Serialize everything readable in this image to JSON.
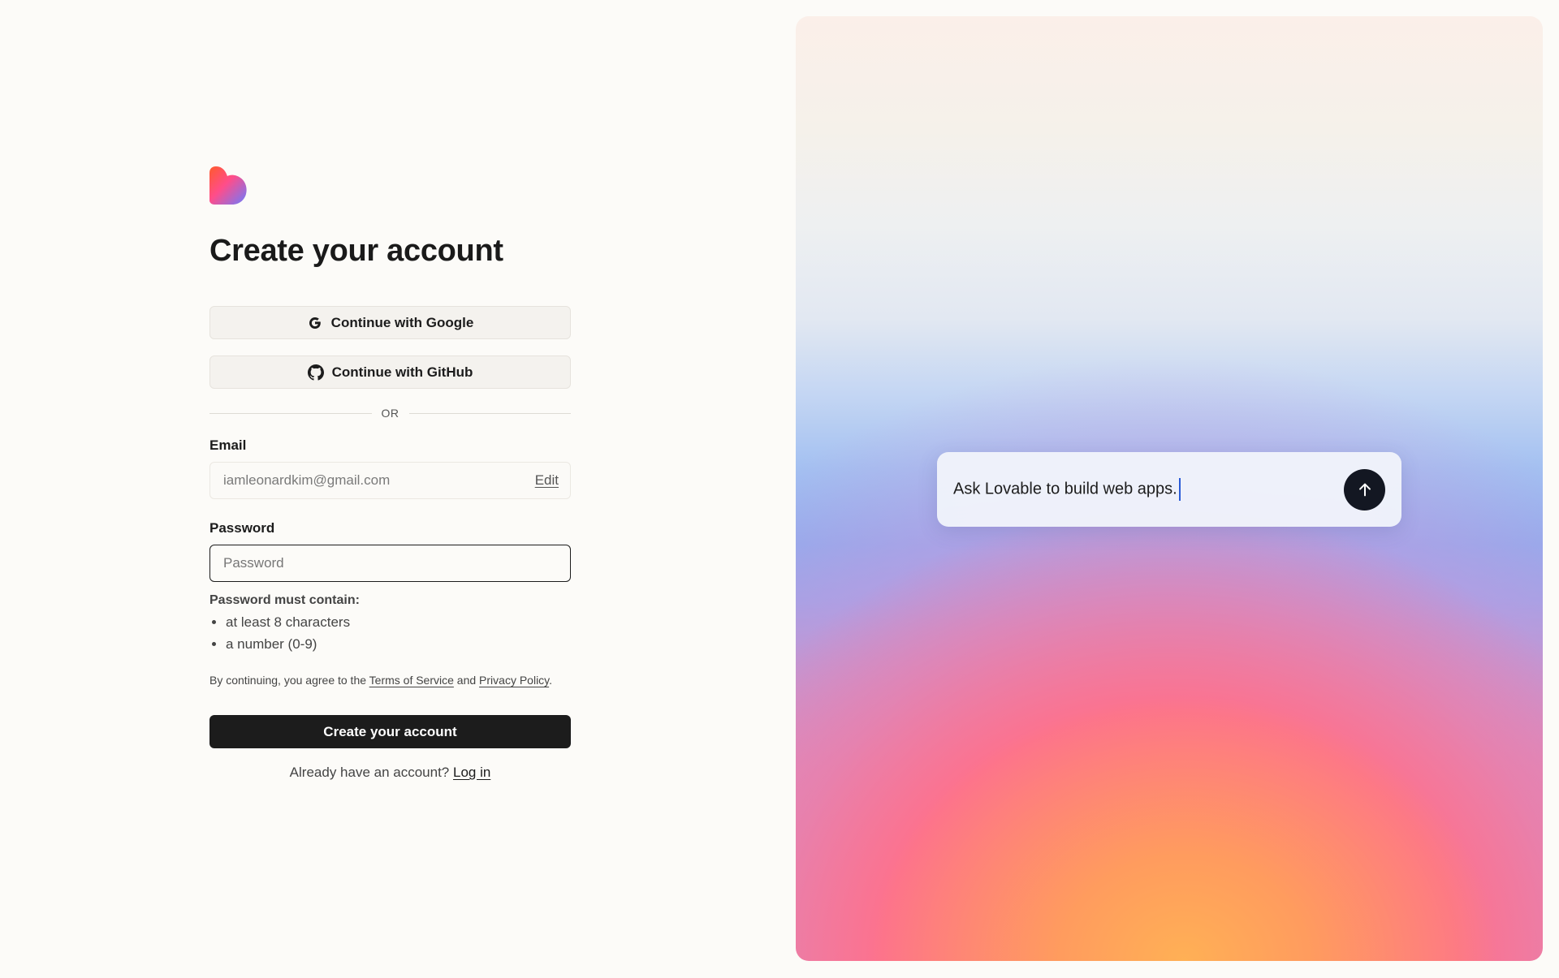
{
  "signup": {
    "title": "Create your account",
    "google_label": "Continue with Google",
    "github_label": "Continue with GitHub",
    "divider_text": "OR",
    "email": {
      "label": "Email",
      "value": "iamleonardkim@gmail.com",
      "edit_label": "Edit"
    },
    "password": {
      "label": "Password",
      "placeholder": "Password"
    },
    "requirements": {
      "title": "Password must contain:",
      "items": [
        "at least 8 characters",
        "a number (0-9)"
      ]
    },
    "terms": {
      "prefix": "By continuing, you agree to the ",
      "tos_label": "Terms of Service",
      "middle": " and ",
      "privacy_label": "Privacy Policy",
      "suffix": "."
    },
    "submit_label": "Create your account",
    "login": {
      "prompt": "Already have an account? ",
      "link_label": "Log in"
    }
  },
  "hero": {
    "prompt_text": "Ask Lovable to build web apps."
  },
  "icons": {
    "logo": "lovable-heart-logo",
    "google": "google-icon",
    "github": "github-icon",
    "send": "arrow-up-icon"
  },
  "colors": {
    "background": "#fcfbf8",
    "primary_button": "#1c1c1c",
    "send_button": "#131722",
    "caret": "#2a5bd7"
  }
}
